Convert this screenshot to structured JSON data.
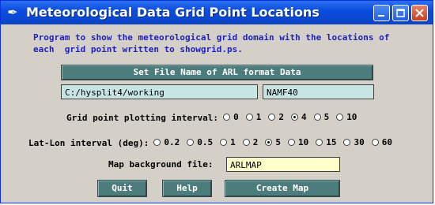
{
  "window": {
    "title": "Meteorological Data Grid Point Locations"
  },
  "description": {
    "line1": "Program to show the meteorological grid domain with the locations of",
    "line2": "each  grid point written to showgrid.ps."
  },
  "set_file_button": "Set File Name of ARL format Data",
  "directory_field": "C:/hysplit4/working",
  "file_field": "NAMF40",
  "grid_interval": {
    "label": "Grid point plotting interval:",
    "options": [
      "0",
      "1",
      "2",
      "4",
      "5",
      "10"
    ],
    "selected": "4"
  },
  "latlon_interval": {
    "label": "Lat-Lon interval (deg):",
    "options": [
      "0.2",
      "0.5",
      "1",
      "2",
      "5",
      "10",
      "15",
      "30",
      "60"
    ],
    "selected": "5"
  },
  "map_background": {
    "label": "Map background file:",
    "value": "ARLMAP"
  },
  "buttons": {
    "quit": "Quit",
    "help": "Help",
    "create_map": "Create Map"
  }
}
